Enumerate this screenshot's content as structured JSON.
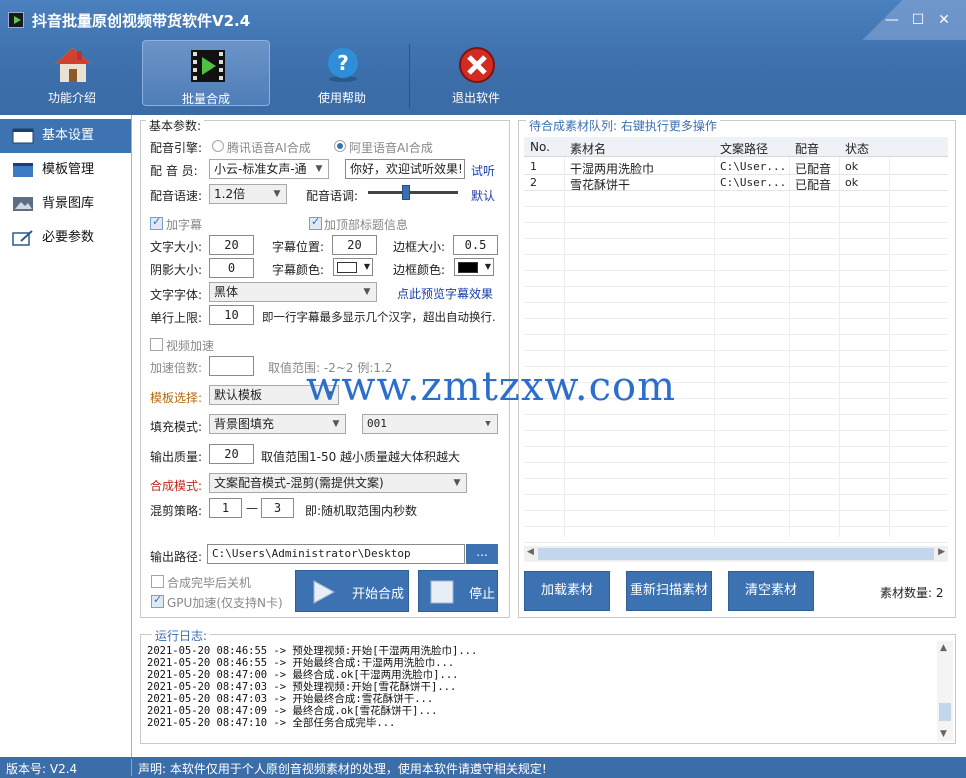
{
  "window": {
    "title": "抖音批量原创视频带货软件V2.4",
    "controls": [
      "—",
      "☐",
      "✕"
    ]
  },
  "toolbar": {
    "items": [
      {
        "label": "功能介绍",
        "icon": "home-icon"
      },
      {
        "label": "批量合成",
        "icon": "film-play-icon",
        "active": true
      },
      {
        "label": "使用帮助",
        "icon": "help-icon"
      },
      {
        "label": "退出软件",
        "icon": "exit-icon"
      }
    ]
  },
  "sidebar": {
    "items": [
      {
        "label": "基本设置",
        "active": true
      },
      {
        "label": "模板管理"
      },
      {
        "label": "背景图库"
      },
      {
        "label": "必要参数"
      }
    ]
  },
  "basic": {
    "legend": "基本参数:",
    "engine_label": "配音引擎:",
    "engine_opt1": "腾讯语音AI合成",
    "engine_opt2": "阿里语音AI合成",
    "voice_label": "配 音 员:",
    "voice_value": "小云-标准女声-通",
    "test_text": "你好，欢迎试听效果!",
    "listen_link": "试听",
    "speed_label": "配音语速:",
    "speed_value": "1.2倍",
    "tone_label": "配音语调:",
    "default_link": "默认",
    "add_subtitle": "加字幕",
    "add_top_title": "加顶部标题信息",
    "font_size_label": "文字大小:",
    "font_size_value": "20",
    "sub_pos_label": "字幕位置:",
    "sub_pos_value": "20",
    "border_size_label": "边框大小:",
    "border_size_value": "0.5",
    "shadow_label": "阴影大小:",
    "shadow_value": "0",
    "sub_color_label": "字幕颜色:",
    "sub_color": "#ffffff",
    "border_color_label": "边框颜色:",
    "border_color": "#000000",
    "font_label": "文字字体:",
    "font_value": "黑体",
    "preview_link": "点此预览字幕效果",
    "line_limit_label": "单行上限:",
    "line_limit_value": "10",
    "line_limit_hint": "即一行字幕最多显示几个汉字，超出自动换行.",
    "video_speed": "视频加速",
    "speed_mult_label": "加速倍数:",
    "speed_mult_value": "",
    "speed_mult_hint": "取值范围: -2~2 例:1.2",
    "template_label": "模板选择:",
    "template_value": "默认模板",
    "fill_label": "填充模式:",
    "fill_value": "背景图填充",
    "fill_value2": "001",
    "quality_label": "输出质量:",
    "quality_value": "20",
    "quality_hint": "取值范围1-50 越小质量越大体积越大",
    "compose_label": "合成模式:",
    "compose_value": "文案配音模式-混剪(需提供文案)",
    "mix_label": "混剪策略:",
    "mix_from": "1",
    "mix_dash": "—",
    "mix_to": "3",
    "mix_hint": "即:随机取范围内秒数",
    "output_label": "输出路径:",
    "output_value": "C:\\Users\\Administrator\\Desktop",
    "browse_label": "...",
    "shutdown_label": "合成完毕后关机",
    "gpu_label": "GPU加速(仅支持N卡)",
    "start_label": "开始合成",
    "stop_label": "停止"
  },
  "queue": {
    "legend": "待合成素材队列: 右键执行更多操作",
    "columns": [
      "No.",
      "素材名",
      "文案路径",
      "配音",
      "状态"
    ],
    "rows": [
      [
        "1",
        "干湿两用洗脸巾",
        "C:\\User...",
        "已配音",
        "ok"
      ],
      [
        "2",
        "雪花酥饼干",
        "C:\\User...",
        "已配音",
        "ok"
      ]
    ],
    "load_label": "加载素材",
    "rescan_label": "重新扫描素材",
    "clear_label": "清空素材",
    "count_label": "素材数量: 2"
  },
  "log": {
    "legend": "运行日志:",
    "lines": [
      "2021-05-20 08:46:55 -> 预处理视频:开始[干湿两用洗脸巾]...",
      "2021-05-20 08:46:55 -> 开始最终合成:干湿两用洗脸巾...",
      "2021-05-20 08:47:00 -> 最终合成.ok[干湿两用洗脸巾]...",
      "2021-05-20 08:47:03 -> 预处理视频:开始[雪花酥饼干]...",
      "2021-05-20 08:47:03 -> 开始最终合成:雪花酥饼干...",
      "2021-05-20 08:47:09 -> 最终合成.ok[雪花酥饼干]...",
      "2021-05-20 08:47:10 -> 全部任务合成完毕..."
    ]
  },
  "status": {
    "version": "版本号: V2.4",
    "notice": "声明: 本软件仅用于个人原创音视频素材的处理，使用本软件请遵守相关规定!"
  },
  "watermark": "www.zmtzxw.com"
}
